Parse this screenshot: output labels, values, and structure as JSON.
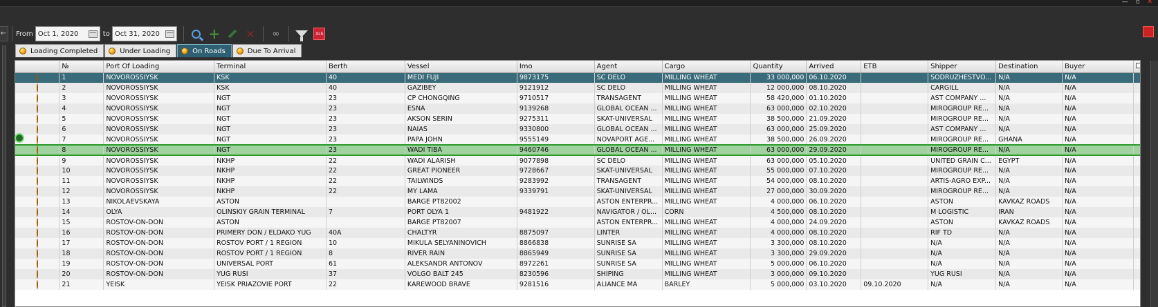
{
  "window": {
    "controls": [
      "—",
      "▫",
      "✕"
    ]
  },
  "toolbar": {
    "collapse_glyph": "←",
    "from_label": "From",
    "from_date": "Oct 1, 2020",
    "to_label": "to",
    "to_date": "Oct 31, 2020",
    "icons": [
      "search-icon",
      "add-icon",
      "edit-icon",
      "delete-icon",
      "binoculars-icon",
      "filter-icon",
      "excel-export-icon"
    ],
    "xls_text": "XLS"
  },
  "tabs": [
    {
      "label": "Loading Completed",
      "active": false
    },
    {
      "label": "Under Loading",
      "active": false
    },
    {
      "label": "On Roads",
      "active": true
    },
    {
      "label": "Due To Arrival",
      "active": false
    }
  ],
  "grid": {
    "columns": [
      "",
      "№",
      "Port Of Loading",
      "Terminal",
      "Berth",
      "Vessel",
      "Imo",
      "Agent",
      "Cargo",
      "Quantity",
      "Arrived",
      "ETB",
      "Shipper",
      "Destination",
      "Buyer"
    ],
    "selected_row": 0,
    "focused_row": 7,
    "rows": [
      [
        "1",
        "NOVOROSSIYSK",
        "KSK",
        "40",
        "MEDI FUJI",
        "9873175",
        "SC DELO",
        "MILLING WHEAT",
        "33 000,000",
        "06.10.2020",
        "",
        "SODRUZHESTVO...",
        "N/A",
        "N/A"
      ],
      [
        "2",
        "NOVOROSSIYSK",
        "KSK",
        "40",
        "GAZIBEY",
        "9121912",
        "SC DELO",
        "MILLING WHEAT",
        "12 000,000",
        "08.10.2020",
        "",
        "CARGILL",
        "N/A",
        "N/A"
      ],
      [
        "3",
        "NOVOROSSIYSK",
        "NGT",
        "23",
        "CP CHONGQING",
        "9710517",
        "TRANSAGENT",
        "MILLING WHEAT",
        "58 420,000",
        "01.10.2020",
        "",
        "AST COMPANY ...",
        "N/A",
        "N/A"
      ],
      [
        "4",
        "NOVOROSSIYSK",
        "NGT",
        "23",
        "ESNA",
        "9139268",
        "GLOBAL OCEAN ...",
        "MILLING WHEAT",
        "63 000,000",
        "02.10.2020",
        "",
        "MIROGROUP RE...",
        "N/A",
        "N/A"
      ],
      [
        "5",
        "NOVOROSSIYSK",
        "NGT",
        "23",
        "AKSON SERIN",
        "9275311",
        "SKAT-UNIVERSAL",
        "MILLING WHEAT",
        "38 500,000",
        "21.09.2020",
        "",
        "MIROGROUP RE...",
        "N/A",
        "N/A"
      ],
      [
        "6",
        "NOVOROSSIYSK",
        "NGT",
        "23",
        "NAIAS",
        "9330800",
        "GLOBAL OCEAN ...",
        "MILLING WHEAT",
        "63 000,000",
        "25.09.2020",
        "",
        "AST COMPANY ...",
        "N/A",
        "N/A"
      ],
      [
        "7",
        "NOVOROSSIYSK",
        "NGT",
        "23",
        "PAPA JOHN",
        "9555149",
        "NOVAPORT AGE...",
        "MILLING WHEAT",
        "38 500,000",
        "26.09.2020",
        "",
        "MIROGROUP RE...",
        "GHANA",
        "N/A"
      ],
      [
        "8",
        "NOVOROSSIYSK",
        "NGT",
        "23",
        "WADI TIBA",
        "9460746",
        "GLOBAL OCEAN ...",
        "MILLING WHEAT",
        "63 000,000",
        "29.09.2020",
        "",
        "MIROGROUP RE...",
        "N/A",
        "N/A"
      ],
      [
        "9",
        "NOVOROSSIYSK",
        "NKHP",
        "22",
        "WADI ALARISH",
        "9077898",
        "SC DELO",
        "MILLING WHEAT",
        "63 000,000",
        "05.10.2020",
        "",
        "UNITED GRAIN C...",
        "EGYPT",
        "N/A"
      ],
      [
        "10",
        "NOVOROSSIYSK",
        "NKHP",
        "22",
        "GREAT PIONEER",
        "9728667",
        "SKAT-UNIVERSAL",
        "MILLING WHEAT",
        "55 000,000",
        "07.10.2020",
        "",
        "MIROGROUP RE...",
        "N/A",
        "N/A"
      ],
      [
        "11",
        "NOVOROSSIYSK",
        "NKHP",
        "22",
        "TAILWINDS",
        "9283992",
        "TRANSAGENT",
        "MILLING WHEAT",
        "54 000,000",
        "08.10.2020",
        "",
        "ARTIS-AGRO EXP...",
        "N/A",
        "N/A"
      ],
      [
        "12",
        "NOVOROSSIYSK",
        "NKHP",
        "22",
        "MY LAMA",
        "9339791",
        "SKAT-UNIVERSAL",
        "MILLING WHEAT",
        "27 000,000",
        "30.09.2020",
        "",
        "MIROGROUP RE...",
        "N/A",
        "N/A"
      ],
      [
        "13",
        "NIKOLAEVSKAYA",
        "ASTON",
        "",
        "BARGE PT82002",
        "",
        "ASTON ENTERPR...",
        "MILLING WHEAT",
        "4 000,000",
        "06.10.2020",
        "",
        "ASTON",
        "KAVKAZ ROADS",
        "N/A"
      ],
      [
        "14",
        "OLYA",
        "OLINSKIY GRAIN TERMINAL",
        "7",
        "PORT OLYA 1",
        "9481922",
        "NAVIGATOR / OL...",
        "CORN",
        "4 500,000",
        "08.10.2020",
        "",
        "M LOGISTIC",
        "IRAN",
        "N/A"
      ],
      [
        "15",
        "ROSTOV-ON-DON",
        "ASTON",
        "",
        "BARGE PT82007",
        "",
        "ASTON ENTERPR...",
        "MILLING WHEAT",
        "4 000,000",
        "24.09.2020",
        "",
        "ASTON",
        "KAVKAZ ROADS",
        "N/A"
      ],
      [
        "16",
        "ROSTOV-ON-DON",
        "PRIMERY DON / ELDAKO YUG",
        "40A",
        "CHALTYR",
        "8875097",
        "LINTER",
        "MILLING WHEAT",
        "4 000,000",
        "08.10.2020",
        "",
        "RIF TD",
        "N/A",
        "N/A"
      ],
      [
        "17",
        "ROSTOV-ON-DON",
        "ROSTOV PORT / 1 REGION",
        "10",
        "MIKULA SELYANINOVICH",
        "8866838",
        "SUNRISE SA",
        "MILLING WHEAT",
        "3 300,000",
        "08.10.2020",
        "",
        "N/A",
        "N/A",
        "N/A"
      ],
      [
        "18",
        "ROSTOV-ON-DON",
        "ROSTOV PORT / 1 REGION",
        "8",
        "RIVER RAIN",
        "8865949",
        "SUNRISE SA",
        "MILLING WHEAT",
        "3 300,000",
        "29.09.2020",
        "",
        "N/A",
        "N/A",
        "N/A"
      ],
      [
        "19",
        "ROSTOV-ON-DON",
        "UNIVERSAL PORT",
        "61",
        "ALEKSANDR ANTONOV",
        "8972261",
        "SUNRISE SA",
        "MILLING WHEAT",
        "5 000,000",
        "06.10.2020",
        "",
        "N/A",
        "N/A",
        "N/A"
      ],
      [
        "20",
        "ROSTOV-ON-DON",
        "YUG RUSI",
        "37",
        "VOLGO BALT 245",
        "8230596",
        "SHIPING",
        "MILLING WHEAT",
        "3 000,000",
        "09.10.2020",
        "",
        "YUG RUSI",
        "N/A",
        "N/A"
      ],
      [
        "21",
        "YEISK",
        "YEISK PRIAZOVIE PORT",
        "22",
        "KAREWOOD BRAVE",
        "9281516",
        "ALIANCE MA",
        "BARLEY",
        "5 000,000",
        "03.10.2020",
        "09.10.2020",
        "N/A",
        "N/A",
        "N/A"
      ]
    ]
  }
}
